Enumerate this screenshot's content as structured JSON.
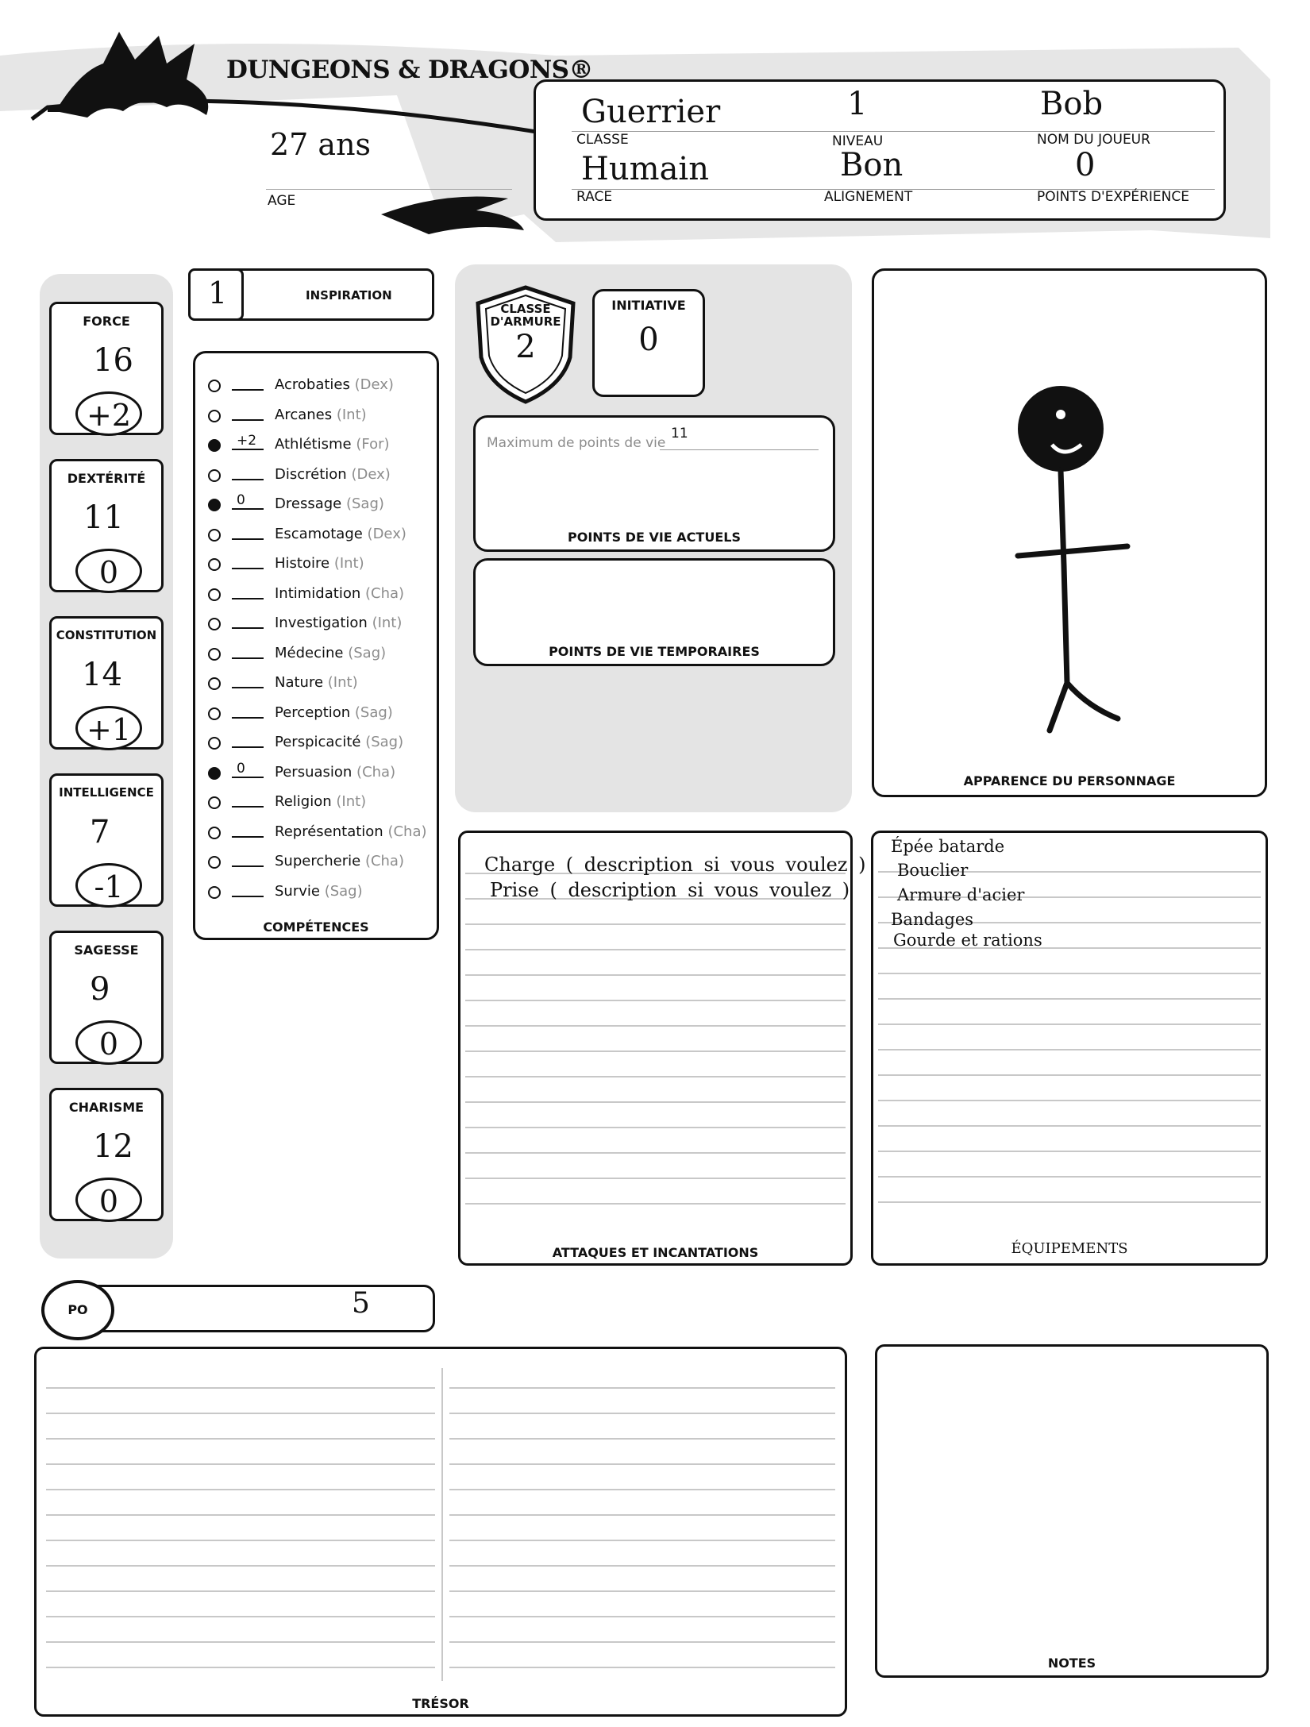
{
  "header": {
    "logo_text": "DUNGEONS & DRAGONS®",
    "age_value": "27 ans",
    "age_label": "AGE",
    "class_value": "Guerrier",
    "class_label": "CLASSE",
    "level_value": "1",
    "level_label": "NIVEAU",
    "player_value": "Bob",
    "player_label": "NOM DU JOUEUR",
    "race_value": "Humain",
    "race_label": "RACE",
    "alignment_value": "Bon",
    "alignment_label": "ALIGNEMENT",
    "xp_value": "0",
    "xp_label": "POINTS D'EXPÉRIENCE"
  },
  "abilities": [
    {
      "name": "FORCE",
      "score": "16",
      "mod": "+2"
    },
    {
      "name": "DEXTÉRITÉ",
      "score": "11",
      "mod": "0"
    },
    {
      "name": "CONSTITUTION",
      "score": "14",
      "mod": "+1"
    },
    {
      "name": "INTELLIGENCE",
      "score": "7",
      "mod": "-1"
    },
    {
      "name": "SAGESSE",
      "score": "9",
      "mod": "0"
    },
    {
      "name": "CHARISME",
      "score": "12",
      "mod": "0"
    }
  ],
  "inspiration": {
    "value": "1",
    "label": "INSPIRATION"
  },
  "skills": {
    "title": "COMPÉTENCES",
    "items": [
      {
        "name": "Acrobaties",
        "attr": "(Dex)",
        "value": "",
        "proficient": false
      },
      {
        "name": "Arcanes",
        "attr": "(Int)",
        "value": "",
        "proficient": false
      },
      {
        "name": "Athlétisme",
        "attr": "(For)",
        "value": "+2",
        "proficient": true
      },
      {
        "name": "Discrétion",
        "attr": "(Dex)",
        "value": "",
        "proficient": false
      },
      {
        "name": "Dressage",
        "attr": "(Sag)",
        "value": "0",
        "proficient": true
      },
      {
        "name": "Escamotage",
        "attr": "(Dex)",
        "value": "",
        "proficient": false
      },
      {
        "name": "Histoire",
        "attr": "(Int)",
        "value": "",
        "proficient": false
      },
      {
        "name": "Intimidation",
        "attr": "(Cha)",
        "value": "",
        "proficient": false
      },
      {
        "name": "Investigation",
        "attr": "(Int)",
        "value": "",
        "proficient": false
      },
      {
        "name": "Médecine",
        "attr": "(Sag)",
        "value": "",
        "proficient": false
      },
      {
        "name": "Nature",
        "attr": "(Int)",
        "value": "",
        "proficient": false
      },
      {
        "name": "Perception",
        "attr": "(Sag)",
        "value": "",
        "proficient": false
      },
      {
        "name": "Perspicacité",
        "attr": "(Sag)",
        "value": "",
        "proficient": false
      },
      {
        "name": "Persuasion",
        "attr": "(Cha)",
        "value": "0",
        "proficient": true
      },
      {
        "name": "Religion",
        "attr": "(Int)",
        "value": "",
        "proficient": false
      },
      {
        "name": "Représentation",
        "attr": "(Cha)",
        "value": "",
        "proficient": false
      },
      {
        "name": "Supercherie",
        "attr": "(Cha)",
        "value": "",
        "proficient": false
      },
      {
        "name": "Survie",
        "attr": "(Sag)",
        "value": "",
        "proficient": false
      }
    ]
  },
  "combat": {
    "ac_label_1": "CLASSE",
    "ac_label_2": "D'ARMURE",
    "ac_value": "2",
    "initiative_label": "INITIATIVE",
    "initiative_value": "0",
    "hp_max_label": "Maximum de points de vie",
    "hp_max_value": "11",
    "hp_current_label": "POINTS DE VIE ACTUELS",
    "hp_temp_label": "POINTS DE VIE TEMPORAIRES"
  },
  "appearance": {
    "label": "APPARENCE DU PERSONNAGE"
  },
  "attacks": {
    "label": "ATTAQUES ET INCANTATIONS",
    "lines": [
      "Charge ( description si vous voulez )",
      "Prise ( description si vous voulez )"
    ]
  },
  "equipment": {
    "label": "ÉQUIPEMENTS",
    "items": [
      "Épée batarde",
      "Bouclier",
      "Armure d'acier",
      "Bandages",
      "Gourde et rations"
    ]
  },
  "gold": {
    "label": "PO",
    "value": "5"
  },
  "treasure": {
    "label": "TRÉSOR"
  },
  "notes": {
    "label": "NOTES"
  }
}
